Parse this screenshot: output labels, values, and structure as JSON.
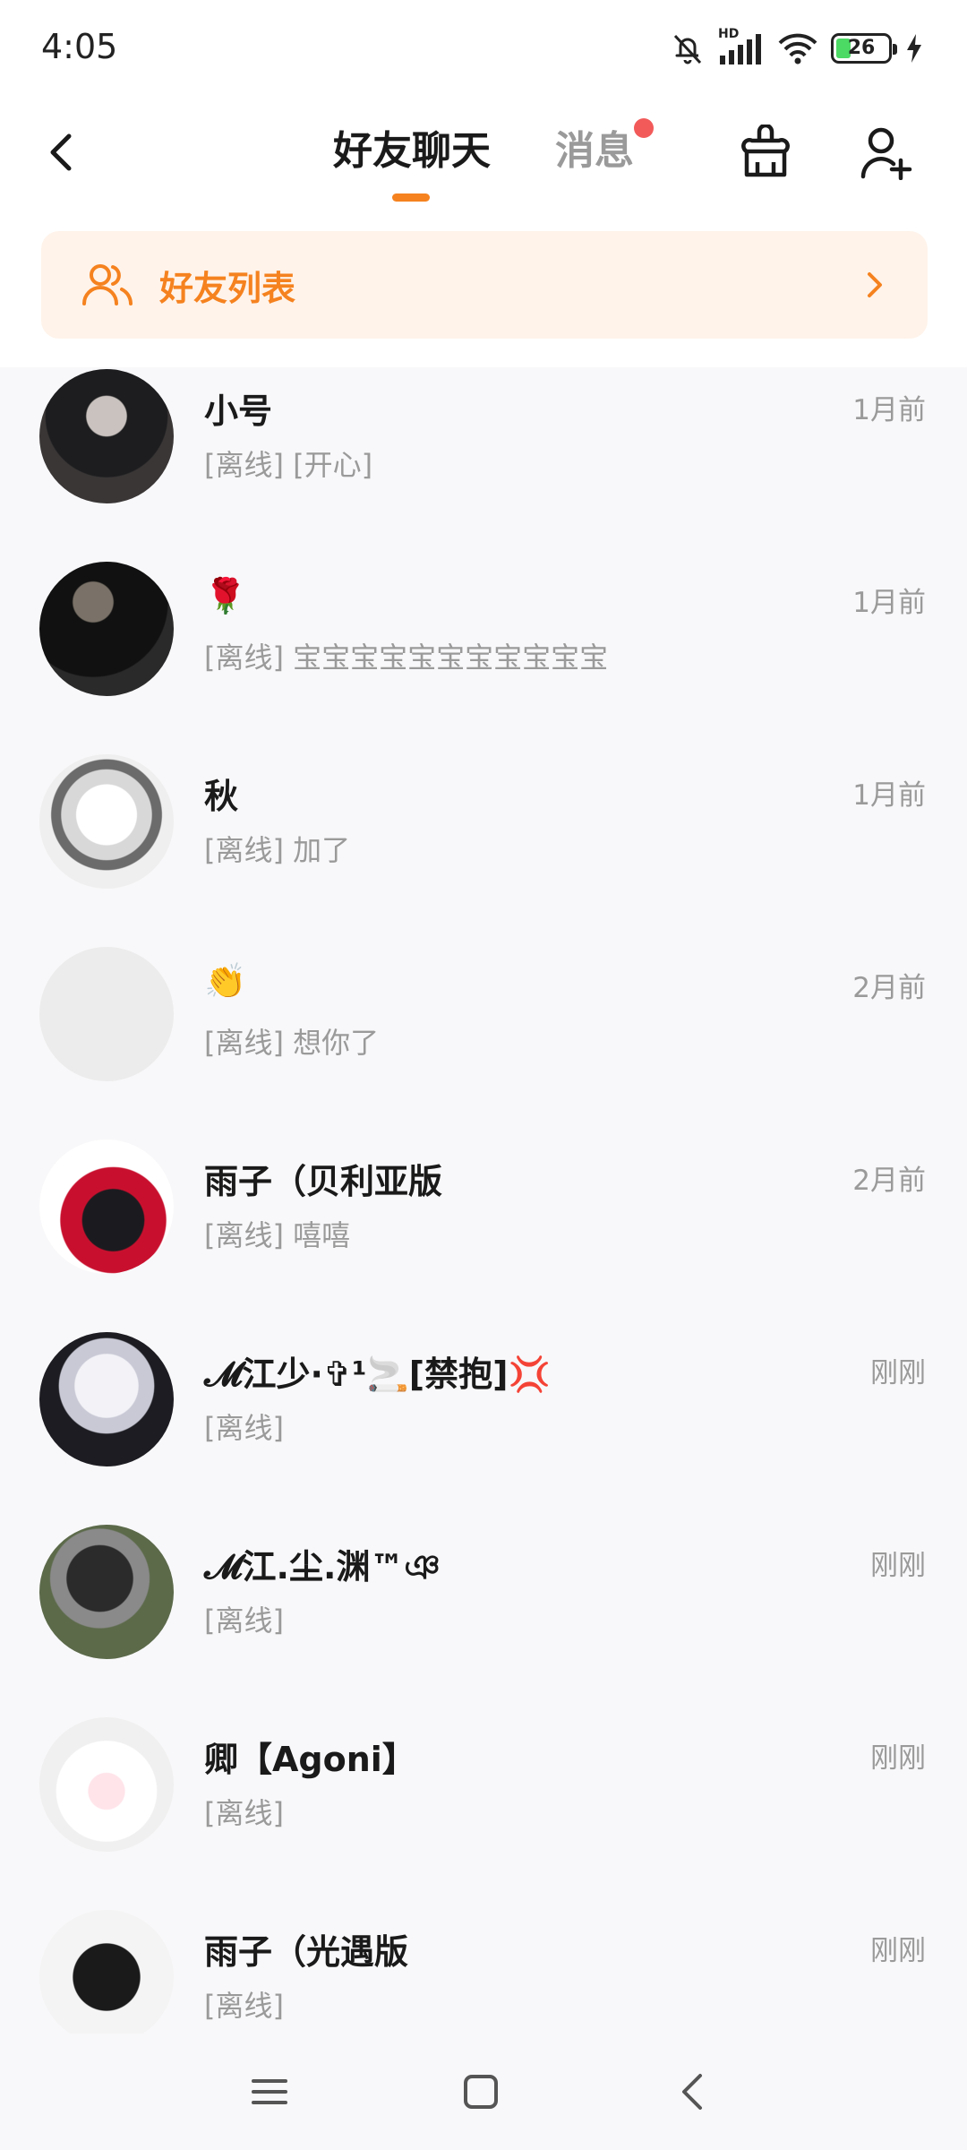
{
  "status_bar": {
    "time": "4:05",
    "network_label": "HD",
    "battery": "26",
    "battery_level": 0.26
  },
  "header": {
    "tabs": [
      {
        "label": "好友聊天",
        "active": true
      },
      {
        "label": "消息",
        "active": false,
        "has_unread_dot": true
      }
    ],
    "accent_color": "#f5821f",
    "unread_dot_color": "#f25a5a"
  },
  "banner": {
    "label": "好友列表",
    "background_color": "#fff3ea"
  },
  "chats": [
    {
      "name": "小号",
      "preview": "[离线] [开心]",
      "time": "1月前"
    },
    {
      "name": "🌹",
      "preview": "[离线] 宝宝宝宝宝宝宝宝宝宝宝",
      "time": "1月前"
    },
    {
      "name": "秋",
      "preview": "[离线] 加了",
      "time": "1月前"
    },
    {
      "name": "👏",
      "preview": "[离线] 想你了",
      "time": "2月前"
    },
    {
      "name": "雨子（贝利亚版",
      "preview": "[离线] 嘻嘻",
      "time": "2月前"
    },
    {
      "name": "𝓜江少·✞¹🚬[禁抱]💢",
      "preview": "[离线]",
      "time": "刚刚"
    },
    {
      "name": "𝓜江.尘.渊™ঞ",
      "preview": "[离线]",
      "time": "刚刚"
    },
    {
      "name": "卿【Agoni】",
      "preview": "[离线]",
      "time": "刚刚"
    },
    {
      "name": "雨子（光遇版",
      "preview": "[离线]",
      "time": "刚刚"
    }
  ],
  "icons": {
    "back": "back-arrow-icon",
    "clean": "broom-clean-icon",
    "add_friend": "add-friend-icon",
    "friends": "friends-icon",
    "chevron": "chevron-right-icon"
  }
}
